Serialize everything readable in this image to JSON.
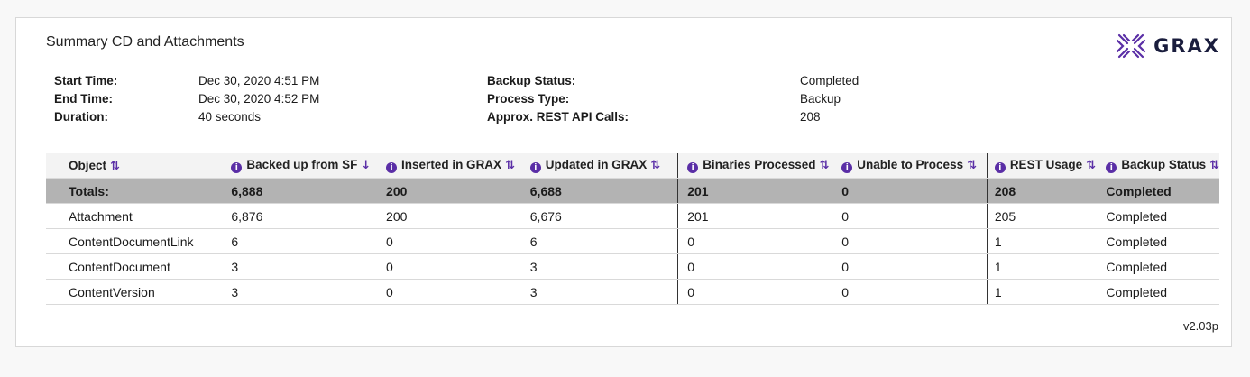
{
  "report": {
    "title": "Summary CD and Attachments",
    "logo_text": "GRAX",
    "version": "v2.03p"
  },
  "details_left": [
    {
      "label": "Start Time:",
      "value": "Dec 30, 2020 4:51 PM"
    },
    {
      "label": "End Time:",
      "value": "Dec 30, 2020 4:52 PM"
    },
    {
      "label": "Duration:",
      "value": "40 seconds"
    }
  ],
  "details_right": [
    {
      "label": "Backup Status:",
      "value": "Completed"
    },
    {
      "label": "Process Type:",
      "value": "Backup"
    },
    {
      "label": "Approx. REST API Calls:",
      "value": "208"
    }
  ],
  "table": {
    "columns": [
      {
        "label": "Object",
        "info": false,
        "sort": "⇅"
      },
      {
        "label": "Backed up from SF",
        "info": true,
        "sort": "↓"
      },
      {
        "label": "Inserted in GRAX",
        "info": true,
        "sort": "⇅"
      },
      {
        "label": "Updated in GRAX",
        "info": true,
        "sort": "⇅"
      },
      {
        "label": "Binaries Processed",
        "info": true,
        "sort": "⇅"
      },
      {
        "label": "Unable to Process",
        "info": true,
        "sort": "⇅"
      },
      {
        "label": "REST Usage",
        "info": true,
        "sort": "⇅"
      },
      {
        "label": "Backup Status",
        "info": true,
        "sort": "⇅"
      }
    ],
    "totals": [
      "Totals:",
      "6,888",
      "200",
      "6,688",
      "201",
      "0",
      "208",
      "Completed"
    ],
    "rows": [
      [
        "Attachment",
        "6,876",
        "200",
        "6,676",
        "201",
        "0",
        "205",
        "Completed"
      ],
      [
        "ContentDocumentLink",
        "6",
        "0",
        "6",
        "0",
        "0",
        "1",
        "Completed"
      ],
      [
        "ContentDocument",
        "3",
        "0",
        "3",
        "0",
        "0",
        "1",
        "Completed"
      ],
      [
        "ContentVersion",
        "3",
        "0",
        "3",
        "0",
        "0",
        "1",
        "Completed"
      ]
    ]
  },
  "colors": {
    "accent": "#5a2ea6",
    "totals_bg": "#b3b3b3",
    "logo": "#1a1d3d"
  }
}
